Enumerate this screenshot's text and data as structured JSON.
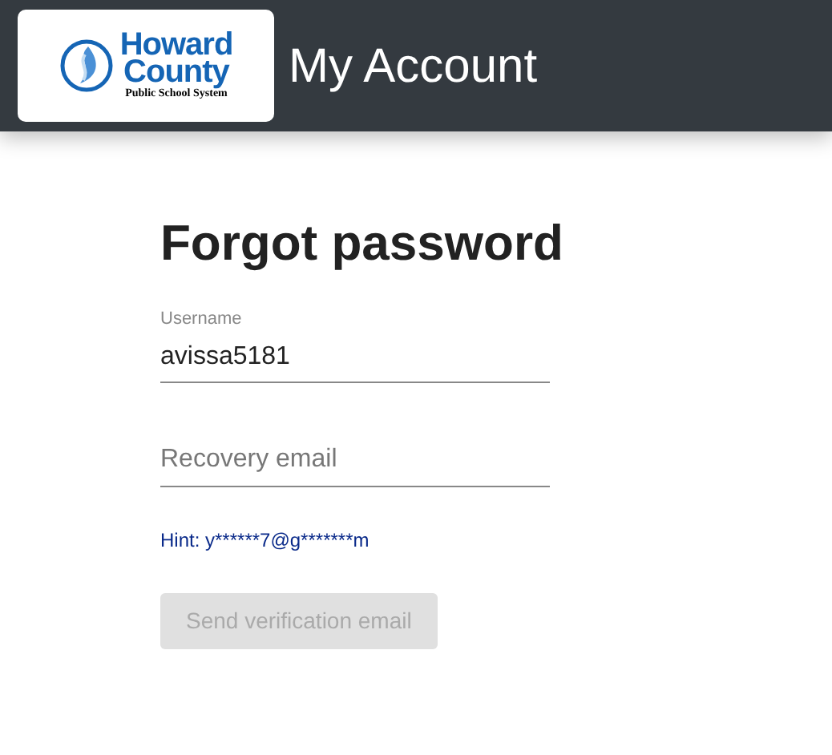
{
  "header": {
    "logo": {
      "line_1": "Howard",
      "line_2": "County",
      "line_3": "Public School System"
    },
    "title": "My Account"
  },
  "form": {
    "heading": "Forgot password",
    "username": {
      "label": "Username",
      "value": "avissa5181"
    },
    "recovery_email": {
      "placeholder": "Recovery email"
    },
    "hint": "Hint: y******7@g*******m",
    "button": {
      "label": "Send verification email",
      "disabled": true
    }
  }
}
